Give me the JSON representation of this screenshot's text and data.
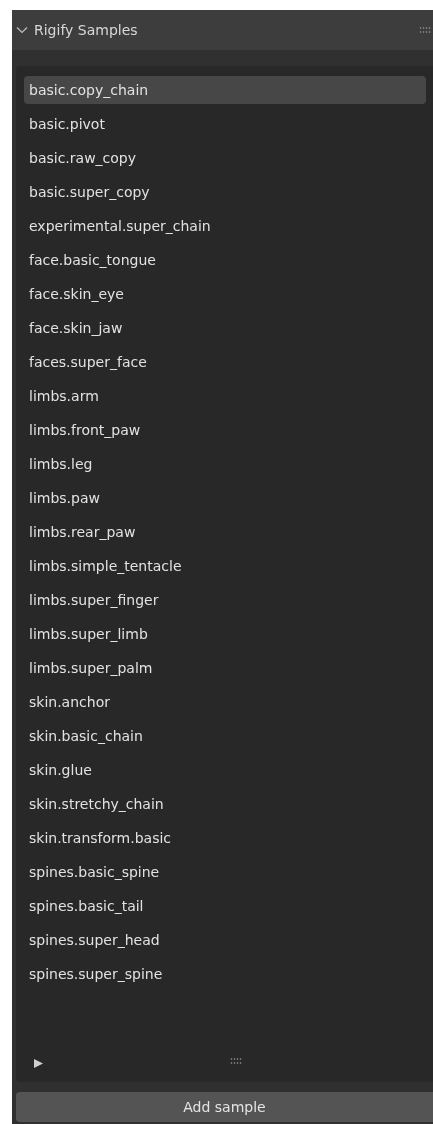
{
  "panel": {
    "title": "Rigify Samples",
    "expanded": true
  },
  "samples": [
    {
      "label": "basic.copy_chain",
      "selected": true
    },
    {
      "label": "basic.pivot",
      "selected": false
    },
    {
      "label": "basic.raw_copy",
      "selected": false
    },
    {
      "label": "basic.super_copy",
      "selected": false
    },
    {
      "label": "experimental.super_chain",
      "selected": false
    },
    {
      "label": "face.basic_tongue",
      "selected": false
    },
    {
      "label": "face.skin_eye",
      "selected": false
    },
    {
      "label": "face.skin_jaw",
      "selected": false
    },
    {
      "label": "faces.super_face",
      "selected": false
    },
    {
      "label": "limbs.arm",
      "selected": false
    },
    {
      "label": "limbs.front_paw",
      "selected": false
    },
    {
      "label": "limbs.leg",
      "selected": false
    },
    {
      "label": "limbs.paw",
      "selected": false
    },
    {
      "label": "limbs.rear_paw",
      "selected": false
    },
    {
      "label": "limbs.simple_tentacle",
      "selected": false
    },
    {
      "label": "limbs.super_finger",
      "selected": false
    },
    {
      "label": "limbs.super_limb",
      "selected": false
    },
    {
      "label": "limbs.super_palm",
      "selected": false
    },
    {
      "label": "skin.anchor",
      "selected": false
    },
    {
      "label": "skin.basic_chain",
      "selected": false
    },
    {
      "label": "skin.glue",
      "selected": false
    },
    {
      "label": "skin.stretchy_chain",
      "selected": false
    },
    {
      "label": "skin.transform.basic",
      "selected": false
    },
    {
      "label": "spines.basic_spine",
      "selected": false
    },
    {
      "label": "spines.basic_tail",
      "selected": false
    },
    {
      "label": "spines.super_head",
      "selected": false
    },
    {
      "label": "spines.super_spine",
      "selected": false
    }
  ],
  "list_options": {
    "expanded": false
  },
  "button": "Add sample"
}
